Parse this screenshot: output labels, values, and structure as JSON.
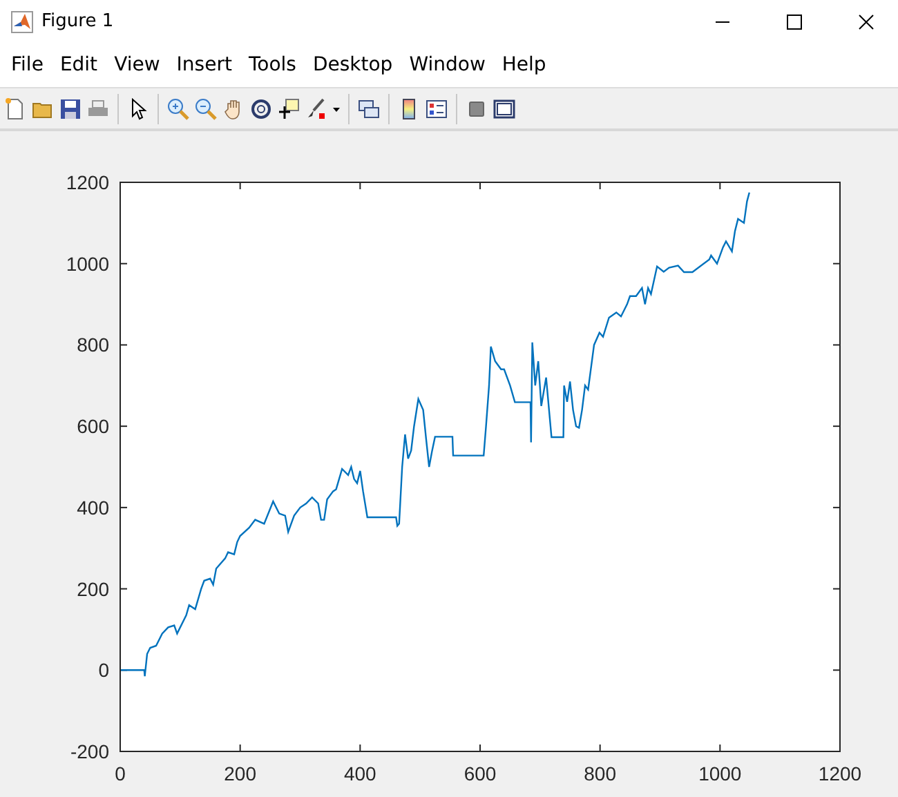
{
  "window": {
    "title": "Figure 1"
  },
  "menu": [
    "File",
    "Edit",
    "View",
    "Insert",
    "Tools",
    "Desktop",
    "Window",
    "Help"
  ],
  "figure": {
    "chart_data": {
      "type": "line",
      "xlim": [
        0,
        1200
      ],
      "ylim": [
        -200,
        1200
      ],
      "xticks": [
        0,
        200,
        400,
        600,
        800,
        1000,
        1200
      ],
      "yticks": [
        -200,
        0,
        200,
        400,
        600,
        800,
        1000,
        1200
      ],
      "x": [
        0,
        40,
        41,
        45,
        50,
        60,
        70,
        80,
        90,
        95,
        110,
        115,
        125,
        135,
        140,
        150,
        155,
        160,
        175,
        180,
        190,
        195,
        200,
        215,
        225,
        240,
        255,
        265,
        275,
        280,
        290,
        300,
        310,
        320,
        330,
        335,
        340,
        345,
        355,
        360,
        370,
        380,
        385,
        390,
        395,
        400,
        405,
        412,
        460,
        462,
        465,
        470,
        475,
        480,
        485,
        490,
        497,
        505,
        510,
        515,
        520,
        525,
        554,
        555,
        606,
        610,
        615,
        618,
        625,
        635,
        640,
        650,
        658,
        684,
        685,
        687,
        692,
        697,
        702,
        710,
        719,
        739,
        740,
        745,
        750,
        755,
        760,
        765,
        770,
        775,
        780,
        790,
        799,
        805,
        815,
        827,
        835,
        845,
        850,
        860,
        870,
        875,
        880,
        885,
        895,
        906,
        915,
        930,
        940,
        954,
        982,
        985,
        995,
        1005,
        1010,
        1020,
        1025,
        1030,
        1040,
        1045,
        1049
      ],
      "series": [
        {
          "color": "#0072bd",
          "values": [
            0,
            0,
            -15,
            40,
            55,
            60,
            90,
            105,
            110,
            90,
            135,
            160,
            150,
            200,
            220,
            225,
            210,
            250,
            275,
            290,
            285,
            315,
            330,
            350,
            370,
            360,
            415,
            385,
            380,
            340,
            380,
            400,
            410,
            425,
            410,
            370,
            370,
            420,
            440,
            445,
            495,
            480,
            500,
            470,
            460,
            490,
            440,
            376,
            376,
            355,
            360,
            500,
            580,
            520,
            540,
            600,
            667,
            640,
            570,
            500,
            540,
            574,
            574,
            528,
            528,
            600,
            700,
            796,
            760,
            740,
            740,
            700,
            659,
            659,
            560,
            806,
            700,
            760,
            650,
            720,
            573,
            573,
            700,
            660,
            710,
            640,
            600,
            596,
            640,
            700,
            690,
            800,
            830,
            820,
            867,
            880,
            870,
            900,
            920,
            920,
            940,
            900,
            940,
            925,
            993,
            980,
            990,
            995,
            979,
            979,
            1010,
            1020,
            1000,
            1040,
            1055,
            1030,
            1080,
            1110,
            1100,
            1153,
            1175
          ]
        }
      ]
    }
  }
}
